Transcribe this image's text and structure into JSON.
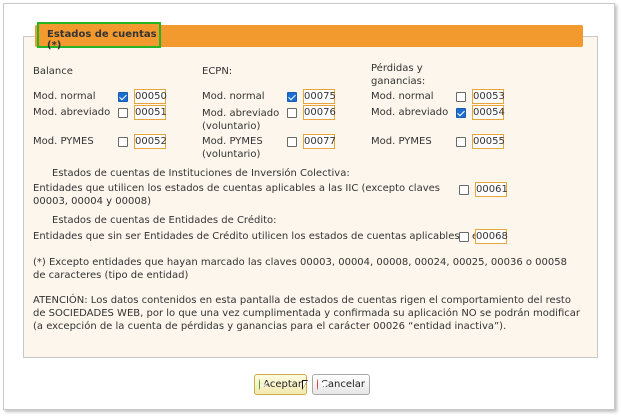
{
  "panel": {
    "title": "Estados de cuentas (*)"
  },
  "columns": [
    {
      "header": "Balance",
      "rows": [
        {
          "label": "Mod. normal",
          "checked": true,
          "code": "00050"
        },
        {
          "label": "Mod. abreviado",
          "checked": false,
          "code": "00051"
        },
        {
          "label": "Mod. PYMES",
          "checked": false,
          "code": "00052"
        }
      ]
    },
    {
      "header": "ECPN:",
      "rows": [
        {
          "label": "Mod. normal",
          "checked": true,
          "code": "00075"
        },
        {
          "label": "Mod. abreviado (voluntario)",
          "checked": false,
          "code": "00076"
        },
        {
          "label": "Mod. PYMES (voluntario)",
          "checked": false,
          "code": "00077"
        }
      ]
    },
    {
      "header": "Pérdidas y ganancias:",
      "rows": [
        {
          "label": "Mod. normal",
          "checked": false,
          "code": "00053"
        },
        {
          "label": "Mod. abreviado",
          "checked": true,
          "code": "00054"
        },
        {
          "label": "Mod. PYMES",
          "checked": false,
          "code": "00055"
        }
      ]
    }
  ],
  "iic": {
    "heading": "Estados de cuentas de Instituciones de Inversión Colectiva:",
    "label": "Entidades que utilicen los estados de cuentas aplicables a las IIC (excepto claves 00003, 00004 y 00008)",
    "checked": false,
    "code": "00061"
  },
  "credito": {
    "heading": "Estados de cuentas de Entidades de Crédito:",
    "label": "Entidades que sin ser Entidades de Crédito utilicen los estados de cuentas aplicables a éstas",
    "checked": false,
    "code": "00068"
  },
  "footnote": "(*) Excepto entidades que hayan marcado las claves 00003, 00004, 00008, 00024, 00025, 00036 o 00058 de caracteres (tipo de entidad)",
  "warning": "ATENCIÓN: Los datos contenidos en esta pantalla de estados de cuentas rigen el comportamiento del resto de SOCIEDADES WEB, por lo que una vez cumplimentada y confirmada su aplicación NO se podrán modificar (a excepción de la cuenta de pérdidas y ganancias para el carácter 00026 “entidad inactiva”).",
  "buttons": {
    "accept": "Aceptar",
    "cancel": "Cancelar"
  },
  "colors": {
    "title_bar": "#f29a2e",
    "title_highlight": "#23b525",
    "panel_bg": "#fdf6ec",
    "code_border": "#e8a53c",
    "checkbox_on": "#1a6fd0"
  }
}
